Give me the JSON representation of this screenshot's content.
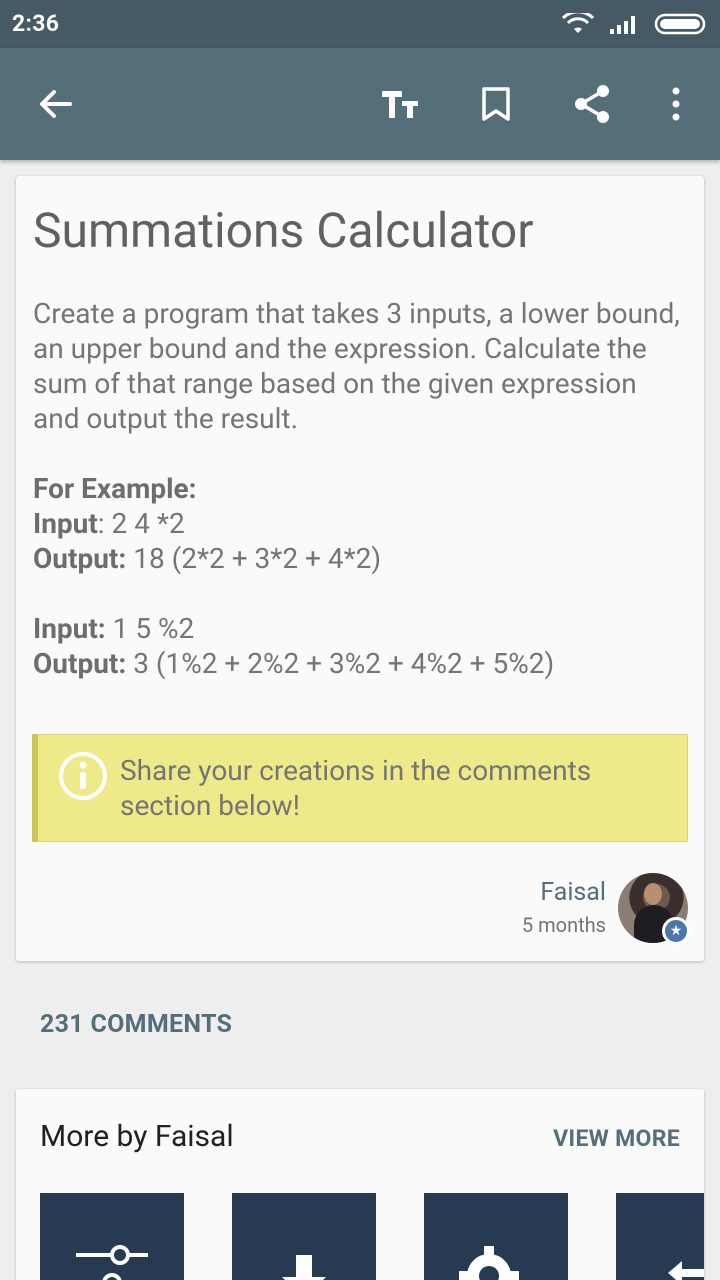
{
  "status_bar": {
    "time": "2:36",
    "icons": [
      "wifi-icon",
      "cellular-signal-icon",
      "battery-icon"
    ]
  },
  "app_bar": {
    "icons": [
      "back-arrow-icon",
      "text-size-icon",
      "bookmark-icon",
      "share-icon",
      "more-vert-icon"
    ]
  },
  "lesson": {
    "title": "Summations Calculator",
    "description": "Create a program that takes 3 inputs, a lower bound, an upper bound and the expression. Calculate the sum of that range based on the given expression and output the result.",
    "example_heading": "For Example:",
    "example1_input_label": "Input",
    "example1_input_value": ": 2 4 *2",
    "example1_output_label": "Output:",
    "example1_output_value": " 18 (2*2 + 3*2 + 4*2)",
    "example2_input_label": "Input:",
    "example2_input_value": " 1 5 %2",
    "example2_output_label": "Output:",
    "example2_output_value": " 3 (1%2 + 2%2 + 3%2 + 4%2 + 5%2)",
    "info_text": "Share your creations in the comments section below!",
    "author_name": "Faisal",
    "author_time": "5 months"
  },
  "comments_label": "231 COMMENTS",
  "more": {
    "title": "More by Faisal",
    "view_more": "VIEW MORE",
    "thumbnails": [
      "sliders-icon",
      "download-icon",
      "gears-icon",
      "arrows-icon"
    ]
  },
  "colors": {
    "status_bar": "#455a64",
    "app_bar": "#546e7a",
    "info_bg": "#eeea8a",
    "thumb_bg": "#263b52"
  }
}
